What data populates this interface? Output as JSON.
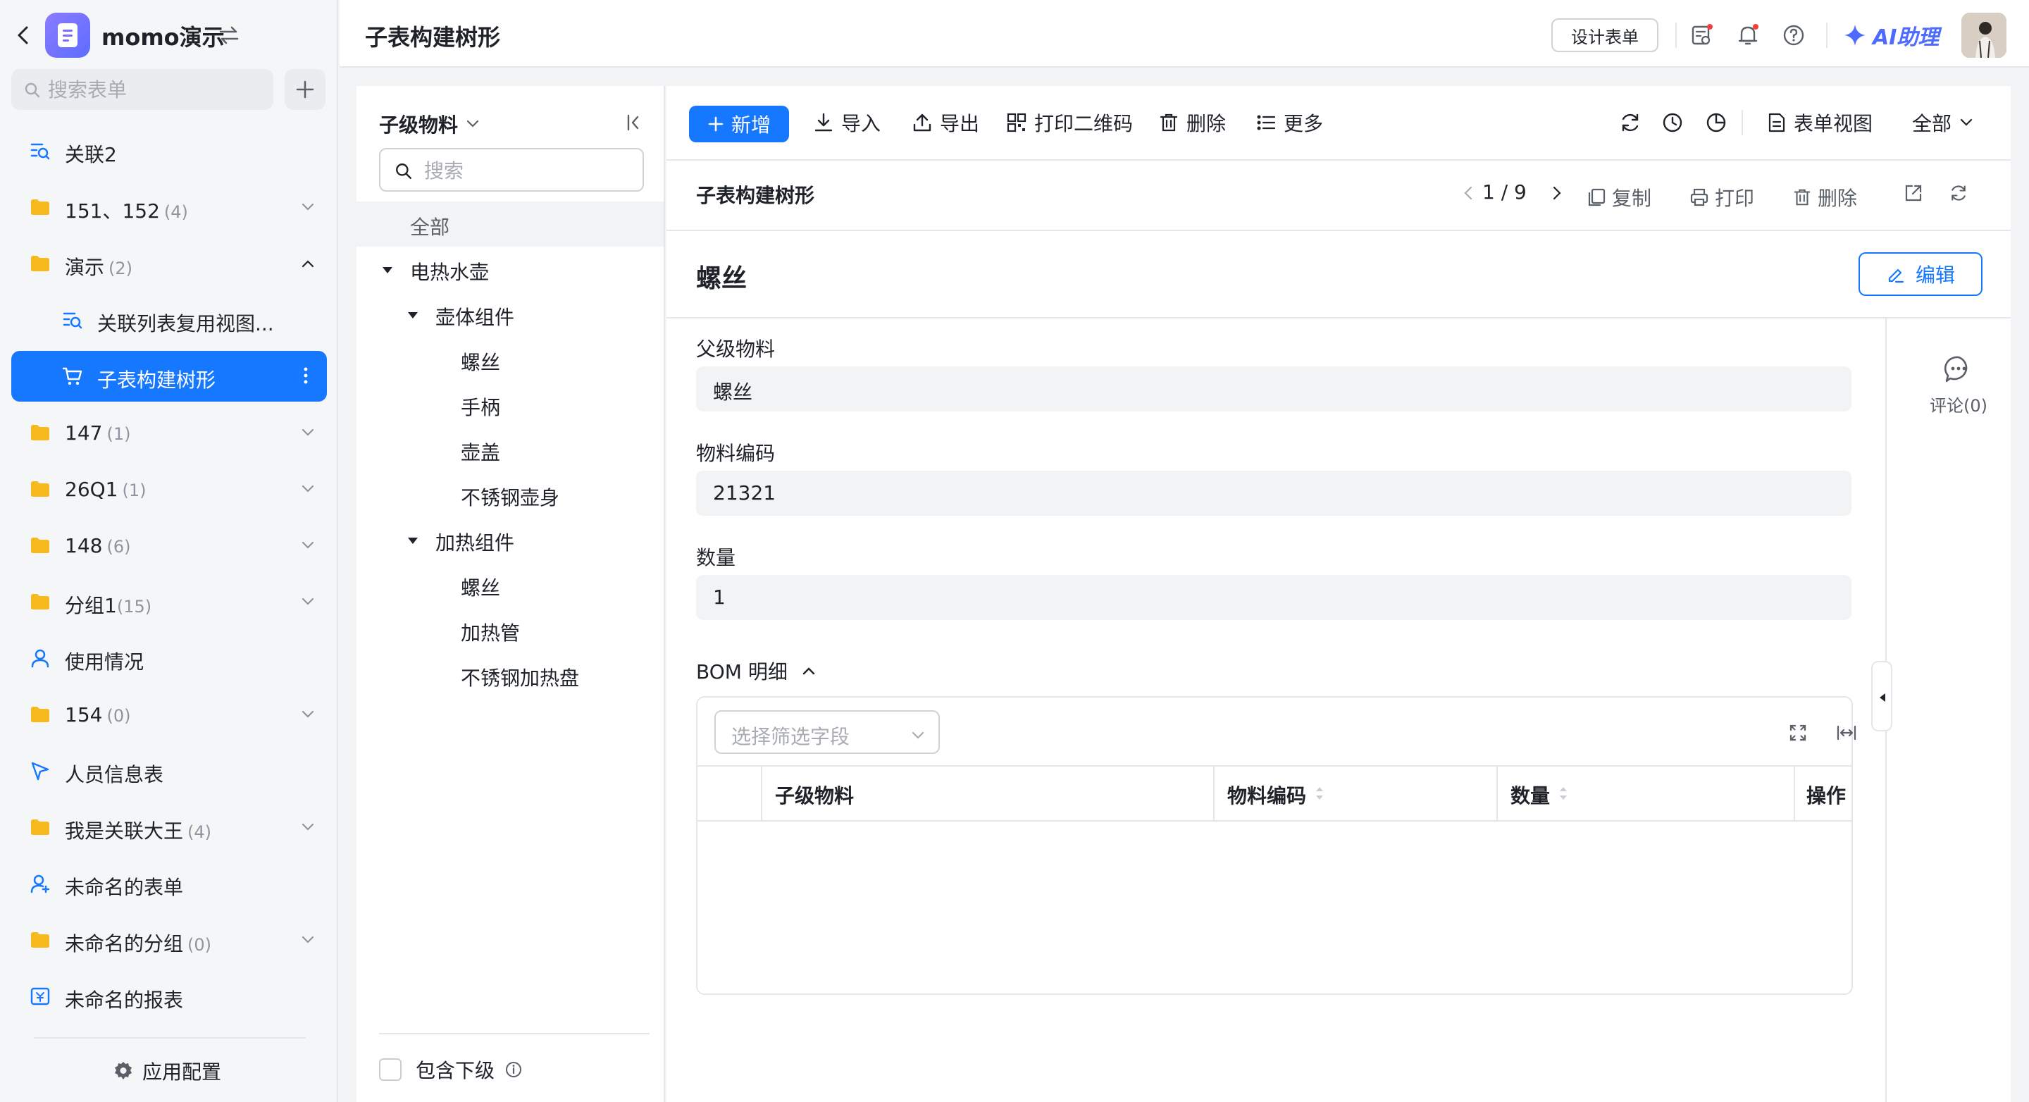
{
  "app": {
    "name": "momo演示",
    "search_placeholder": "搜索表单",
    "config_label": "应用配置"
  },
  "sidebar": {
    "items": [
      {
        "label": "关联2",
        "count": "",
        "icon": "search-list-icon"
      },
      {
        "label": "151、152",
        "count": "(4)",
        "icon": "folder-icon"
      },
      {
        "label": "演示",
        "count": "(2)",
        "icon": "folder-icon"
      },
      {
        "label": "关联列表复用视图...",
        "count": "",
        "icon": "search-list-icon"
      },
      {
        "label": "子表构建树形",
        "count": "",
        "icon": "cart-icon"
      },
      {
        "label": "147",
        "count": "(1)",
        "icon": "folder-icon"
      },
      {
        "label": "26Q1",
        "count": "(1)",
        "icon": "folder-icon"
      },
      {
        "label": "148",
        "count": "(6)",
        "icon": "folder-icon"
      },
      {
        "label": "分组1",
        "count": "(15)",
        "icon": "folder-icon"
      },
      {
        "label": "使用情况",
        "count": "",
        "icon": "user-icon"
      },
      {
        "label": "154",
        "count": "(0)",
        "icon": "folder-icon"
      },
      {
        "label": "人员信息表",
        "count": "",
        "icon": "send-icon"
      },
      {
        "label": "我是关联大王",
        "count": "(4)",
        "icon": "folder-icon"
      },
      {
        "label": "未命名的表单",
        "count": "",
        "icon": "user-add-icon"
      },
      {
        "label": "未命名的分组",
        "count": "(0)",
        "icon": "folder-icon"
      },
      {
        "label": "未命名的报表",
        "count": "",
        "icon": "report-icon"
      }
    ]
  },
  "header": {
    "title": "子表构建树形",
    "design_button": "设计表单",
    "ai_label": "AI助理"
  },
  "tree": {
    "title": "子级物料",
    "search_placeholder": "搜索",
    "all_label": "全部",
    "nodes": [
      {
        "label": "电热水壶"
      },
      {
        "label": "壶体组件"
      },
      {
        "label": "螺丝"
      },
      {
        "label": "手柄"
      },
      {
        "label": "壶盖"
      },
      {
        "label": "不锈钢壶身"
      },
      {
        "label": "加热组件"
      },
      {
        "label": "螺丝"
      },
      {
        "label": "加热管"
      },
      {
        "label": "不锈钢加热盘"
      }
    ],
    "include_children": "包含下级"
  },
  "toolbar": {
    "add": "新增",
    "import": "导入",
    "export": "导出",
    "print_qr": "打印二维码",
    "delete": "删除",
    "more": "更多",
    "form_view": "表单视图",
    "scope": "全部"
  },
  "record": {
    "form_title": "子表构建树形",
    "pager": "1 / 9",
    "copy": "复制",
    "print": "打印",
    "delete": "删除",
    "name": "螺丝",
    "edit": "编辑",
    "fields": [
      {
        "label": "父级物料",
        "value": "螺丝"
      },
      {
        "label": "物料编码",
        "value": "21321"
      },
      {
        "label": "数量",
        "value": "1"
      }
    ],
    "comment": "评论(0)"
  },
  "bom": {
    "title": "BOM 明细",
    "filter_placeholder": "选择筛选字段",
    "columns": [
      "子级物料",
      "物料编码",
      "数量",
      "操作"
    ]
  },
  "colors": {
    "accent": "#1677ff",
    "folder": "#f7ba1e",
    "ai": "#4e6bff"
  }
}
